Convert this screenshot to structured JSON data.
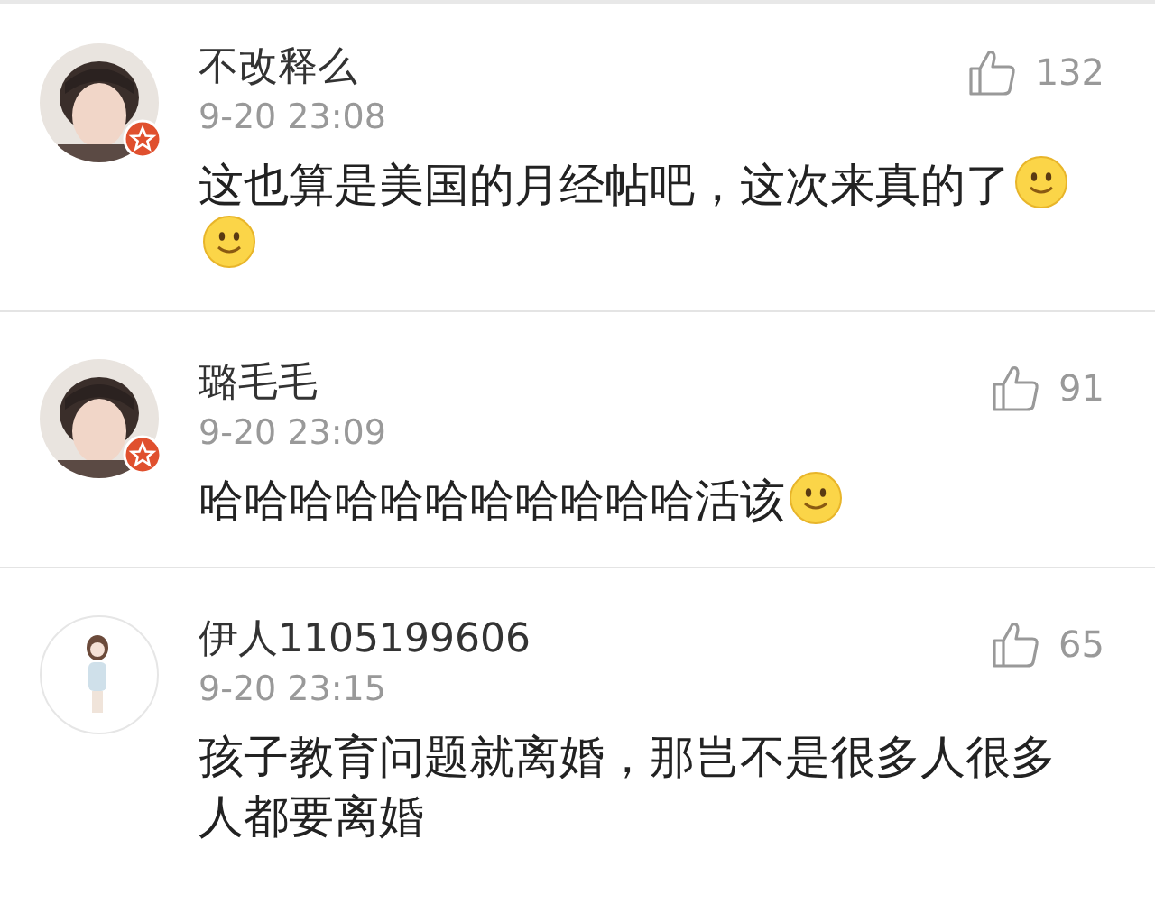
{
  "comments": [
    {
      "avatar": {
        "kind": "dark"
      },
      "verified": true,
      "name": "不改释么",
      "time": "9-20 23:08",
      "likes": "132",
      "text": "这也算是美国的月经帖吧，这次来真的了",
      "emoji": [
        {
          "kind": "smile"
        },
        {
          "kind": "smile"
        }
      ]
    },
    {
      "avatar": {
        "kind": "dark"
      },
      "verified": true,
      "name": "璐毛毛",
      "time": "9-20 23:09",
      "likes": "91",
      "text": "哈哈哈哈哈哈哈哈哈哈哈活该",
      "emoji": [
        {
          "kind": "smile"
        }
      ]
    },
    {
      "avatar": {
        "kind": "light"
      },
      "verified": false,
      "name": "伊人1105199606",
      "time": "9-20 23:15",
      "likes": "65",
      "text": "孩子教育问题就离婚，那岂不是很多人很多人都要离婚"
    }
  ]
}
